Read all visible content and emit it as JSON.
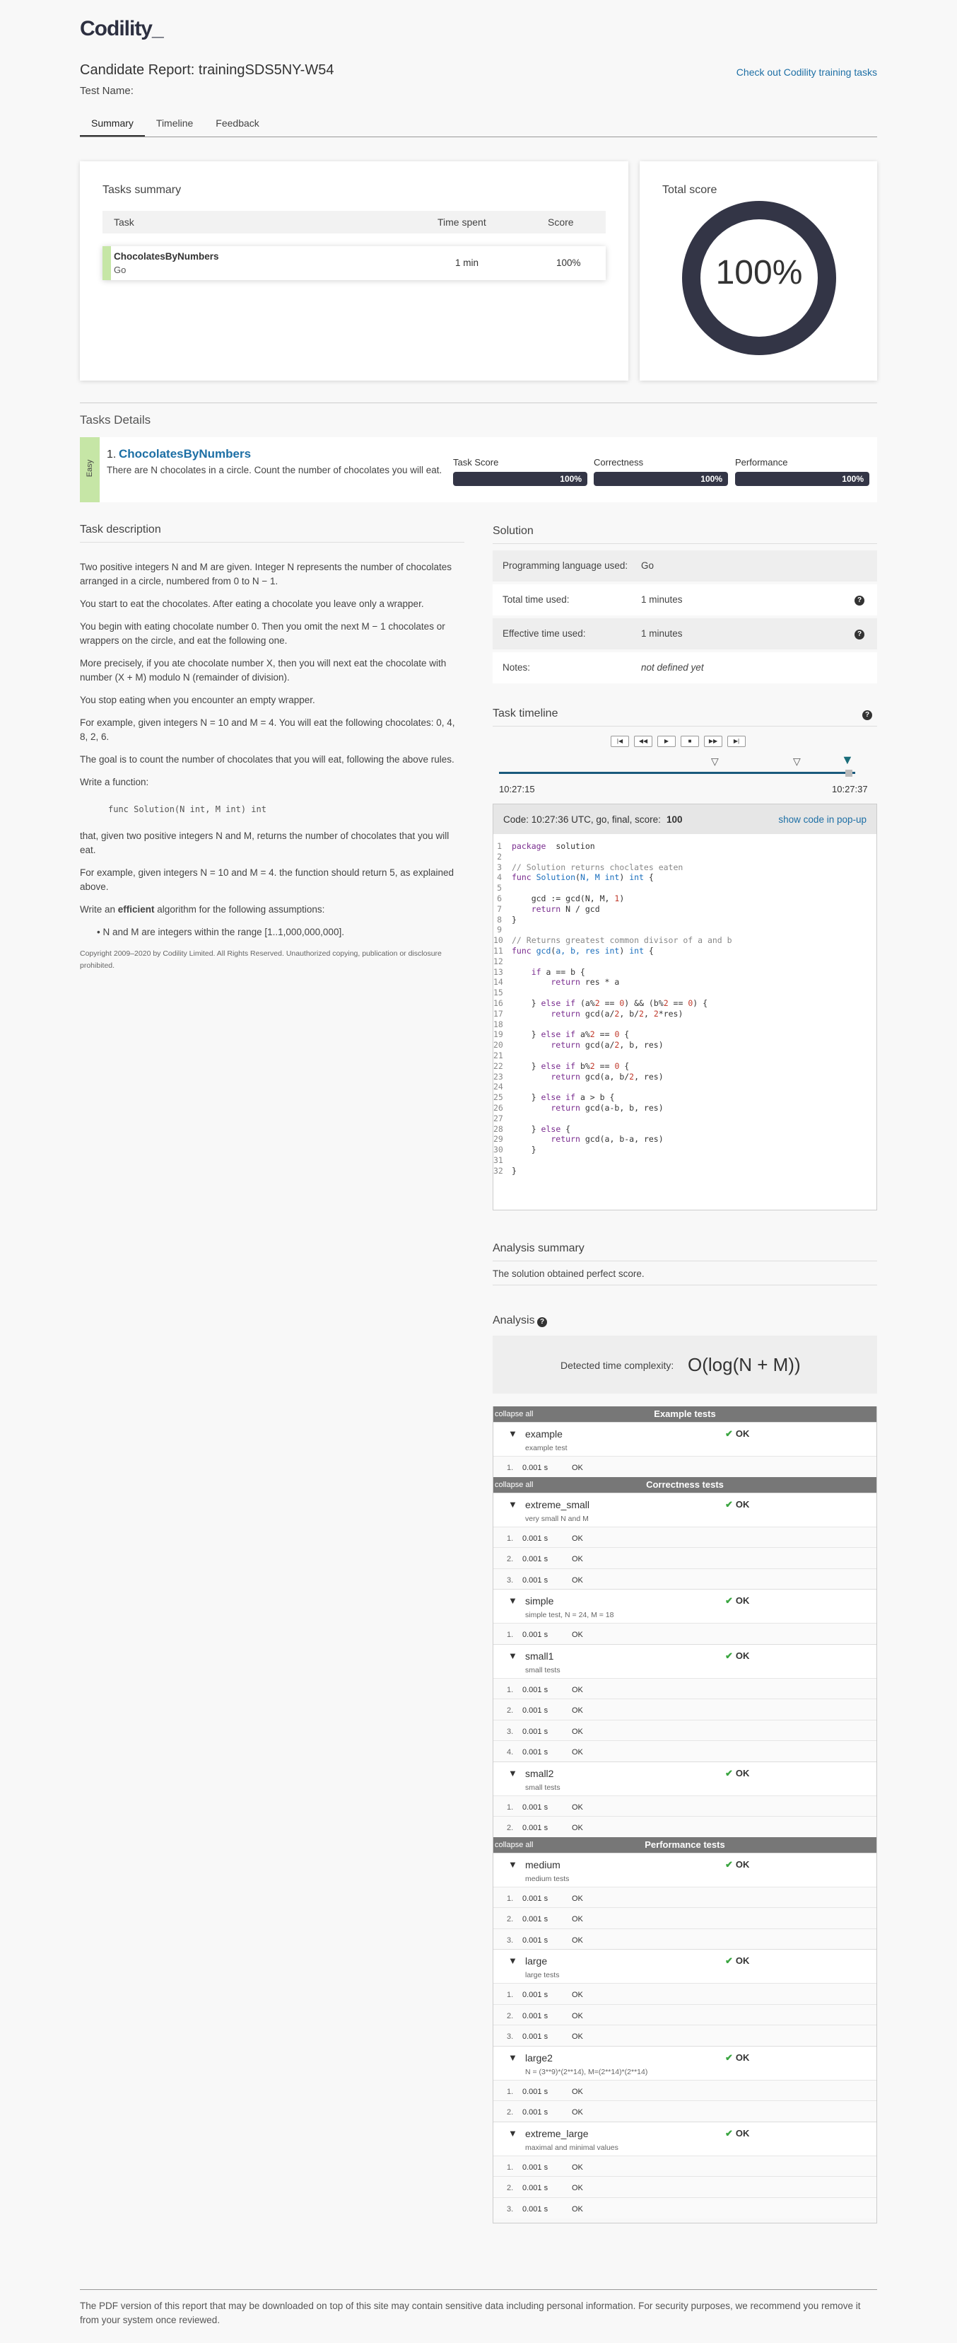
{
  "header": {
    "logo": "Codility_",
    "report_title": "Candidate Report:  trainingSDS5NY-W54",
    "test_name_label": "Test Name:",
    "training_link": "Check out Codility training tasks"
  },
  "tabs": [
    "Summary",
    "Timeline",
    "Feedback"
  ],
  "tasks_summary": {
    "title": "Tasks summary",
    "headers": {
      "task": "Task",
      "time": "Time spent",
      "score": "Score"
    },
    "row": {
      "name": "ChocolatesByNumbers",
      "lang": "Go",
      "time": "1 min",
      "score": "100%"
    }
  },
  "total_score": {
    "title": "Total score",
    "value": "100%"
  },
  "tasks_details": {
    "title": "Tasks Details",
    "difficulty": "Easy",
    "task_number": "1.",
    "task_name": "ChocolatesByNumbers",
    "task_short": "There are N chocolates in a circle. Count the number of chocolates you will eat.",
    "metrics": [
      {
        "label": "Task Score",
        "value": "100%",
        "fraction": 1.0
      },
      {
        "label": "Correctness",
        "value": "100%",
        "fraction": 1.0
      },
      {
        "label": "Performance",
        "value": "100%",
        "fraction": 1.0
      }
    ]
  },
  "description": {
    "title": "Task description",
    "paragraphs": [
      "Two positive integers N and M are given. Integer N represents the number of chocolates arranged in a circle, numbered from 0 to N − 1.",
      "You start to eat the chocolates. After eating a chocolate you leave only a wrapper.",
      "You begin with eating chocolate number 0. Then you omit the next M − 1 chocolates or wrappers on the circle, and eat the following one.",
      "More precisely, if you ate chocolate number X, then you will next eat the chocolate with number (X + M) modulo N (remainder of division).",
      "You stop eating when you encounter an empty wrapper.",
      "For example, given integers N = 10 and M = 4. You will eat the following chocolates: 0, 4, 8, 2, 6.",
      "The goal is to count the number of chocolates that you will eat, following the above rules.",
      "Write a function:"
    ],
    "signature": "func Solution(N int, M int) int",
    "after_sig": "that, given two positive integers N and M, returns the number of chocolates that you will eat.",
    "example": "For example, given integers N = 10 and M = 4. the function should return 5, as explained above.",
    "write_pre": "Write an ",
    "write_bold": "efficient",
    "write_post": " algorithm for the following assumptions:",
    "assumption": "N and M are integers within the range [1..1,000,000,000].",
    "copyright": "Copyright 2009–2020 by Codility Limited. All Rights Reserved. Unauthorized copying, publication or disclosure prohibited."
  },
  "solution": {
    "title": "Solution",
    "rows": [
      {
        "label": "Programming language used:",
        "value": "Go"
      },
      {
        "label": "Total time used:",
        "value": "1 minutes"
      },
      {
        "label": "Effective time used:",
        "value": "1 minutes"
      },
      {
        "label": "Notes:",
        "value": "not defined yet"
      }
    ]
  },
  "timeline": {
    "title": "Task timeline",
    "start": "10:27:15",
    "end": "10:27:37",
    "controls": [
      "|◀",
      "◀◀",
      "▶",
      "■",
      "▶▶",
      "▶|"
    ]
  },
  "code": {
    "header": "Code: 10:27:36 UTC, go, final, score:",
    "score": "100",
    "popup": "show code in pop-up",
    "lines": [
      [
        [
          "kw",
          "package"
        ],
        [
          "",
          "  solution"
        ]
      ],
      [],
      [
        [
          "cm",
          "// Solution returns choclates eaten"
        ]
      ],
      [
        [
          "kw",
          "func "
        ],
        [
          "fn",
          "Solution"
        ],
        [
          "",
          "("
        ],
        [
          "ty",
          "N, M int"
        ],
        [
          "",
          ") "
        ],
        [
          "ty",
          "int"
        ],
        [
          "",
          " {"
        ]
      ],
      [],
      [
        [
          "",
          "    gcd := gcd(N, M, "
        ],
        [
          "nm",
          "1"
        ],
        [
          "",
          ")"
        ]
      ],
      [
        [
          "kw",
          "    return "
        ],
        [
          "",
          "N / gcd"
        ]
      ],
      [
        [
          "",
          "}"
        ]
      ],
      [],
      [
        [
          "cm",
          "// Returns greatest common divisor of a and b"
        ]
      ],
      [
        [
          "kw",
          "func "
        ],
        [
          "fn",
          "gcd"
        ],
        [
          "",
          "("
        ],
        [
          "ty",
          "a, b, res int"
        ],
        [
          "",
          ") "
        ],
        [
          "ty",
          "int"
        ],
        [
          "",
          " {"
        ]
      ],
      [],
      [
        [
          "kw",
          "    if "
        ],
        [
          "",
          "a == b {"
        ]
      ],
      [
        [
          "kw",
          "        return "
        ],
        [
          "",
          "res * a"
        ]
      ],
      [],
      [
        [
          "",
          "    } "
        ],
        [
          "kw",
          "else if "
        ],
        [
          "",
          "(a%"
        ],
        [
          "nm",
          "2"
        ],
        [
          "",
          " == "
        ],
        [
          "nm",
          "0"
        ],
        [
          "",
          ") && (b%"
        ],
        [
          "nm",
          "2"
        ],
        [
          "",
          " == "
        ],
        [
          "nm",
          "0"
        ],
        [
          "",
          ") {"
        ]
      ],
      [
        [
          "kw",
          "        return "
        ],
        [
          "",
          "gcd(a/"
        ],
        [
          "nm",
          "2"
        ],
        [
          "",
          ", b/"
        ],
        [
          "nm",
          "2"
        ],
        [
          "",
          ", "
        ],
        [
          "nm",
          "2"
        ],
        [
          "",
          "*res)"
        ]
      ],
      [],
      [
        [
          "",
          "    } "
        ],
        [
          "kw",
          "else if "
        ],
        [
          "",
          "a%"
        ],
        [
          "nm",
          "2"
        ],
        [
          "",
          " == "
        ],
        [
          "nm",
          "0"
        ],
        [
          "",
          " {"
        ]
      ],
      [
        [
          "kw",
          "        return "
        ],
        [
          "",
          "gcd(a/"
        ],
        [
          "nm",
          "2"
        ],
        [
          "",
          ", b, res)"
        ]
      ],
      [],
      [
        [
          "",
          "    } "
        ],
        [
          "kw",
          "else if "
        ],
        [
          "",
          "b%"
        ],
        [
          "nm",
          "2"
        ],
        [
          "",
          " == "
        ],
        [
          "nm",
          "0"
        ],
        [
          "",
          " {"
        ]
      ],
      [
        [
          "kw",
          "        return "
        ],
        [
          "",
          "gcd(a, b/"
        ],
        [
          "nm",
          "2"
        ],
        [
          "",
          ", res)"
        ]
      ],
      [],
      [
        [
          "",
          "    } "
        ],
        [
          "kw",
          "else if "
        ],
        [
          "",
          "a > b {"
        ]
      ],
      [
        [
          "kw",
          "        return "
        ],
        [
          "",
          "gcd(a-b, b, res)"
        ]
      ],
      [],
      [
        [
          "",
          "    } "
        ],
        [
          "kw",
          "else "
        ],
        [
          "",
          "{"
        ]
      ],
      [
        [
          "kw",
          "        return "
        ],
        [
          "",
          "gcd(a, b-a, res)"
        ]
      ],
      [
        [
          "",
          "    }"
        ]
      ],
      [],
      [
        [
          "",
          "}"
        ]
      ]
    ]
  },
  "analysis_summary": {
    "title": "Analysis summary",
    "text": "The solution obtained perfect score."
  },
  "analysis": {
    "title": "Analysis",
    "complexity_label": "Detected time complexity:",
    "complexity_value": "O(log(N + M))",
    "collapse_label": "collapse all",
    "groups": [
      {
        "title": "Example tests",
        "tests": [
          {
            "name": "example",
            "desc": "example test",
            "status": "OK",
            "subs": [
              [
                "1.",
                "0.001 s",
                "OK"
              ]
            ]
          }
        ]
      },
      {
        "title": "Correctness tests",
        "tests": [
          {
            "name": "extreme_small",
            "desc": "very small N and M",
            "status": "OK",
            "subs": [
              [
                "1.",
                "0.001 s",
                "OK"
              ],
              [
                "2.",
                "0.001 s",
                "OK"
              ],
              [
                "3.",
                "0.001 s",
                "OK"
              ]
            ]
          },
          {
            "name": "simple",
            "desc": "simple test, N = 24, M = 18",
            "status": "OK",
            "subs": [
              [
                "1.",
                "0.001 s",
                "OK"
              ]
            ]
          },
          {
            "name": "small1",
            "desc": "small tests",
            "status": "OK",
            "subs": [
              [
                "1.",
                "0.001 s",
                "OK"
              ],
              [
                "2.",
                "0.001 s",
                "OK"
              ],
              [
                "3.",
                "0.001 s",
                "OK"
              ],
              [
                "4.",
                "0.001 s",
                "OK"
              ]
            ]
          },
          {
            "name": "small2",
            "desc": "small tests",
            "status": "OK",
            "subs": [
              [
                "1.",
                "0.001 s",
                "OK"
              ],
              [
                "2.",
                "0.001 s",
                "OK"
              ]
            ]
          }
        ]
      },
      {
        "title": "Performance tests",
        "tests": [
          {
            "name": "medium",
            "desc": "medium tests",
            "status": "OK",
            "subs": [
              [
                "1.",
                "0.001 s",
                "OK"
              ],
              [
                "2.",
                "0.001 s",
                "OK"
              ],
              [
                "3.",
                "0.001 s",
                "OK"
              ]
            ]
          },
          {
            "name": "large",
            "desc": "large tests",
            "status": "OK",
            "subs": [
              [
                "1.",
                "0.001 s",
                "OK"
              ],
              [
                "2.",
                "0.001 s",
                "OK"
              ],
              [
                "3.",
                "0.001 s",
                "OK"
              ]
            ]
          },
          {
            "name": "large2",
            "desc": "N = (3**9)*(2**14), M=(2**14)*(2**14)",
            "status": "OK",
            "subs": [
              [
                "1.",
                "0.001 s",
                "OK"
              ],
              [
                "2.",
                "0.001 s",
                "OK"
              ]
            ]
          },
          {
            "name": "extreme_large",
            "desc": "maximal and minimal values",
            "status": "OK",
            "subs": [
              [
                "1.",
                "0.001 s",
                "OK"
              ],
              [
                "2.",
                "0.001 s",
                "OK"
              ],
              [
                "3.",
                "0.001 s",
                "OK"
              ]
            ]
          }
        ]
      }
    ]
  },
  "footer": {
    "text": "The PDF version of this report that may be downloaded on top of this site may contain sensitive data including personal information. For security purposes, we recommend you remove it from your system once reviewed."
  }
}
